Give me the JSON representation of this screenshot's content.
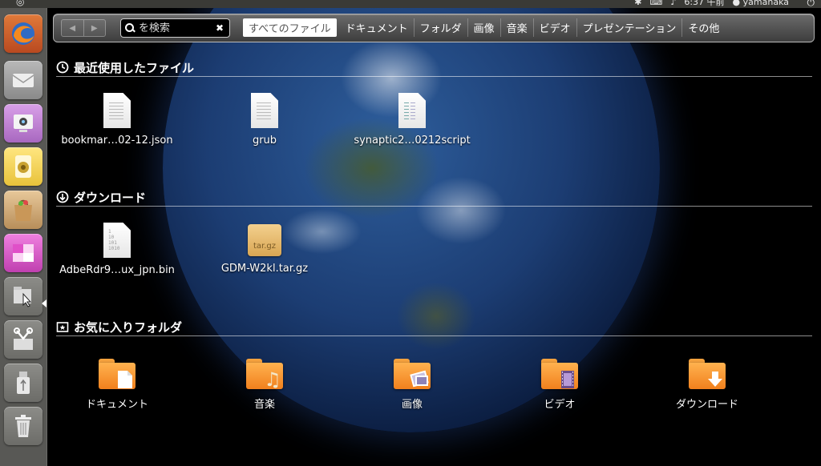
{
  "top_panel": {
    "clock": "6:37 午前",
    "user": "yamanaka"
  },
  "launcher": {
    "items": [
      {
        "name": "firefox",
        "icon": "firefox-icon"
      },
      {
        "name": "mail",
        "icon": "envelope-icon"
      },
      {
        "name": "webcam",
        "icon": "webcam-icon"
      },
      {
        "name": "music-player",
        "icon": "speaker-icon"
      },
      {
        "name": "software-center",
        "icon": "shopping-bag-icon"
      },
      {
        "name": "workspaces",
        "icon": "workspace-switcher-icon"
      },
      {
        "name": "files-folders",
        "icon": "files-folders-icon"
      },
      {
        "name": "applications",
        "icon": "applications-icon"
      },
      {
        "name": "usb-drive",
        "icon": "usb-drive-icon"
      },
      {
        "name": "trash",
        "icon": "trash-icon"
      }
    ]
  },
  "dash": {
    "search": {
      "value": "",
      "placeholder": "を検索"
    },
    "filters": [
      "すべてのファイル",
      "ドキュメント",
      "フォルダ",
      "画像",
      "音楽",
      "ビデオ",
      "プレゼンテーション",
      "その他"
    ],
    "selected_filter": 0,
    "sections": {
      "recent": {
        "title": "最近使用したファイル",
        "icon": "clock-icon",
        "items": [
          {
            "label": "bookmar…02-12.json",
            "icon": "text-file-icon"
          },
          {
            "label": "grub",
            "icon": "text-file-icon"
          },
          {
            "label": "synaptic2…0212script",
            "icon": "script-file-icon"
          }
        ]
      },
      "downloads": {
        "title": "ダウンロード",
        "icon": "download-icon",
        "items": [
          {
            "label": "AdbeRdr9…ux_jpn.bin",
            "icon": "binary-file-icon",
            "icon_text": "1\n10\n101\n1010"
          },
          {
            "label": "GDM-W2kl.tar.gz",
            "icon": "archive-icon",
            "icon_text": "tar.gz"
          }
        ]
      },
      "favorites": {
        "title": "お気に入りフォルダ",
        "icon": "favorite-folder-icon",
        "items": [
          {
            "label": "ドキュメント",
            "icon": "documents-folder-icon"
          },
          {
            "label": "音楽",
            "icon": "music-folder-icon"
          },
          {
            "label": "画像",
            "icon": "pictures-folder-icon"
          },
          {
            "label": "ビデオ",
            "icon": "videos-folder-icon"
          },
          {
            "label": "ダウンロード",
            "icon": "downloads-folder-icon"
          }
        ]
      }
    }
  },
  "colors": {
    "launcher_bg": "#5f5f5c",
    "folder_orange": "#f1801d",
    "dash_bar": "#4d4d4d"
  }
}
